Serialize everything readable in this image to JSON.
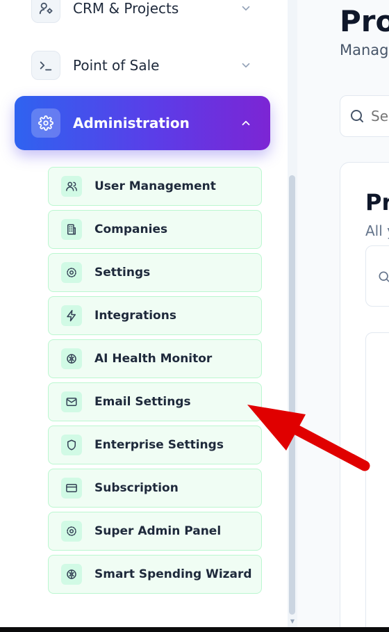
{
  "sidebar": {
    "nav": [
      {
        "label": "CRM & Projects",
        "icon": "user-cog-icon",
        "expanded": false
      },
      {
        "label": "Point of Sale",
        "icon": "terminal-icon",
        "expanded": false
      },
      {
        "label": "Administration",
        "icon": "gear-icon",
        "expanded": true
      }
    ],
    "admin_items": [
      {
        "label": "User Management",
        "icon": "users-icon"
      },
      {
        "label": "Companies",
        "icon": "building-icon"
      },
      {
        "label": "Settings",
        "icon": "gear-icon"
      },
      {
        "label": "Integrations",
        "icon": "lightning-icon"
      },
      {
        "label": "AI Health Monitor",
        "icon": "brain-icon"
      },
      {
        "label": "Email Settings",
        "icon": "mail-icon"
      },
      {
        "label": "Enterprise Settings",
        "icon": "shield-icon"
      },
      {
        "label": "Subscription",
        "icon": "credit-card-icon"
      },
      {
        "label": "Super Admin Panel",
        "icon": "gear-icon"
      },
      {
        "label": "Smart Spending Wizard",
        "icon": "brain-icon"
      }
    ]
  },
  "main": {
    "title": "Pro",
    "subtitle": "Manag",
    "search_placeholder": "Se",
    "card": {
      "title": "Pr",
      "subtitle": "All y"
    }
  },
  "colors": {
    "active_gradient_start": "#2f63f0",
    "active_gradient_end": "#7c25d4",
    "sub_item_bg": "#f0fdf4",
    "sub_item_border": "#bbf7d0",
    "annotation_arrow": "#e00000"
  }
}
